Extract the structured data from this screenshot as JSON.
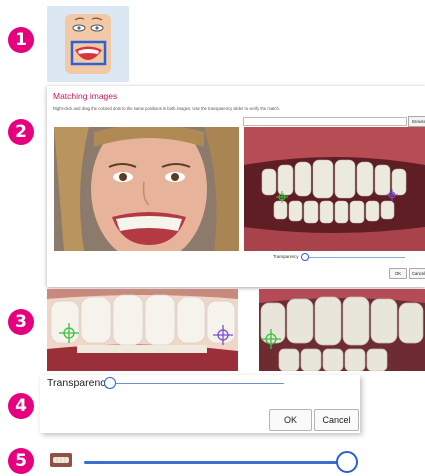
{
  "steps": [
    "1",
    "2",
    "3",
    "4",
    "5"
  ],
  "dialog": {
    "title": "Matching images",
    "instruction": "Right-click and drag the colored dots to the same positions in both images. Use the transparency slider to verify the match.",
    "browse_label": "Browse",
    "transparency_label": "Transparency",
    "ok_label": "OK",
    "cancel_label": "Cancel",
    "transparency_value": 0.0
  },
  "zoom_panel": {
    "transparency_label": "Transparency",
    "ok_label": "OK",
    "cancel_label": "Cancel",
    "transparency_value": 0.0
  },
  "step5_slider": {
    "value": 1.0
  },
  "colors": {
    "badge": "#e6007e",
    "title": "#c2185b",
    "slider_blue": "#2a5fd6",
    "marker_green": "#3fbf3f",
    "marker_purple": "#7a4fd0"
  },
  "icons": [
    "face-mask-icon",
    "tooth-thumbnail-icon"
  ]
}
